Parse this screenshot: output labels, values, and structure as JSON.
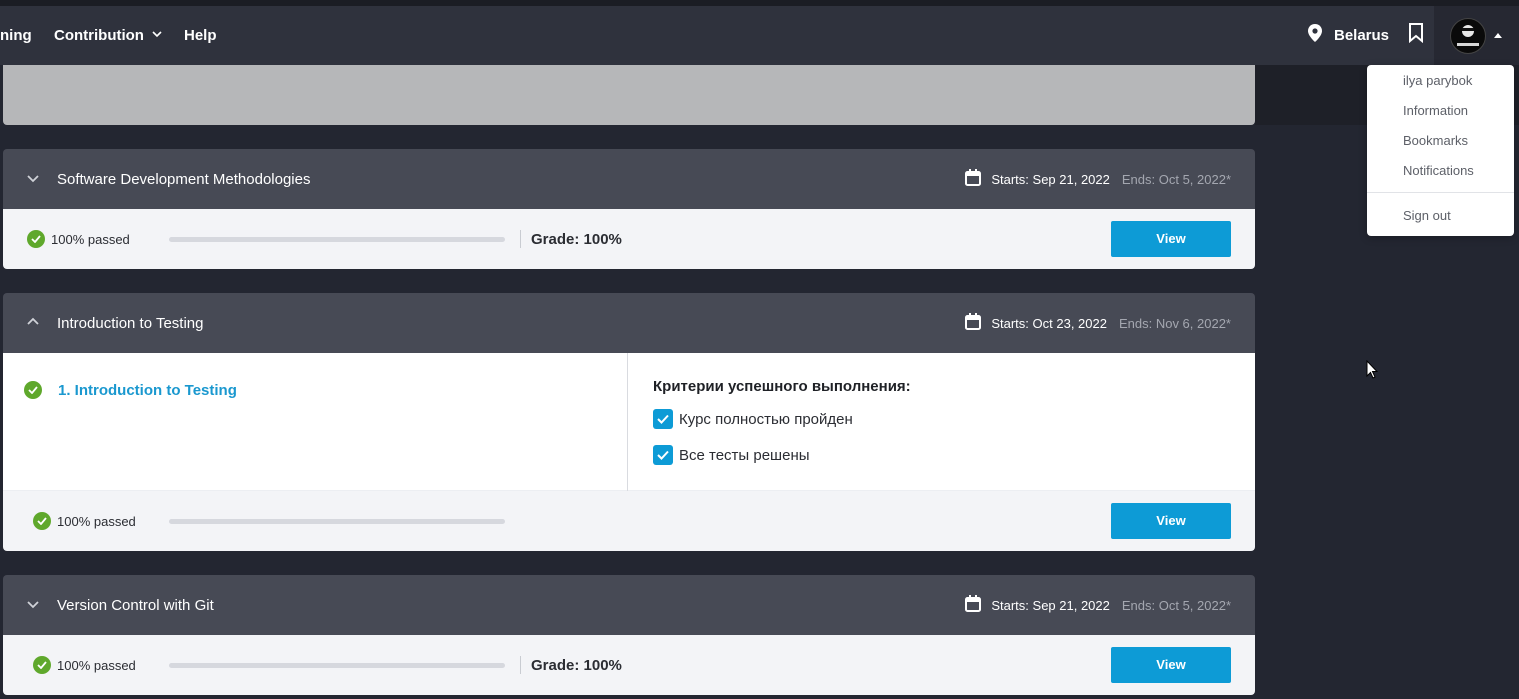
{
  "nav": {
    "partial_item": "ning",
    "contribution": "Contribution",
    "help": "Help",
    "location": "Belarus"
  },
  "user_menu": {
    "name": "ilya parybok",
    "information": "Information",
    "bookmarks": "Bookmarks",
    "notifications": "Notifications",
    "sign_out": "Sign out"
  },
  "courses": [
    {
      "title": "Software Development Methodologies",
      "starts": "Starts: Sep 21, 2022",
      "ends": "Ends: Oct 5, 2022*",
      "passed": "100% passed",
      "progress": 0,
      "grade": "Grade: 100%",
      "view": "View",
      "expanded": false
    },
    {
      "title": "Introduction to Testing",
      "starts": "Starts: Oct 23, 2022",
      "ends": "Ends: Nov 6, 2022*",
      "passed": "100% passed",
      "progress": 0,
      "view": "View",
      "expanded": true,
      "lesson": "1. Introduction to Testing",
      "criteria_title": "Критерии успешного выполнения:",
      "criteria": [
        "Курс полностью пройден",
        "Все тесты решены"
      ]
    },
    {
      "title": "Version Control with Git",
      "starts": "Starts: Sep 21, 2022",
      "ends": "Ends: Oct 5, 2022*",
      "passed": "100% passed",
      "progress": 0,
      "grade": "Grade: 100%",
      "view": "View",
      "expanded": false
    }
  ],
  "colors": {
    "accent": "#0d9bd6",
    "success": "#5fa82c",
    "header": "#474a55",
    "navbar": "#2f323d"
  }
}
